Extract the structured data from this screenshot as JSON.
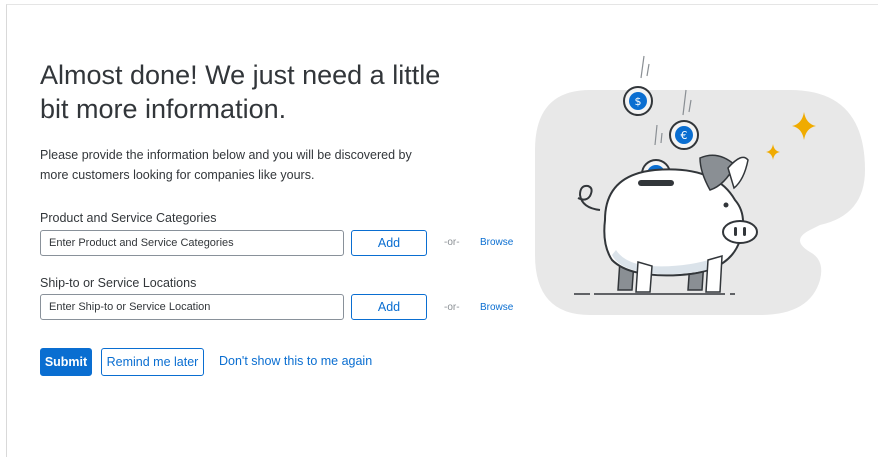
{
  "heading": "Almost done! We just need a little bit more information.",
  "description": "Please provide the information below and you will be discovered by more customers looking for companies like yours.",
  "categories": {
    "label": "Product and Service Categories",
    "placeholder": "Enter Product and Service Categories",
    "add_label": "Add",
    "or_label": "-or-",
    "browse_label": "Browse"
  },
  "locations": {
    "label": "Ship-to or Service Locations",
    "placeholder": "Enter Ship-to or Service Location",
    "add_label": "Add",
    "or_label": "-or-",
    "browse_label": "Browse"
  },
  "actions": {
    "submit_label": "Submit",
    "remind_label": "Remind me later",
    "dont_show_label": "Don't show this to me again"
  },
  "colors": {
    "accent": "#0a6ed1",
    "text": "#32363a",
    "sparkle": "#f0ab00",
    "illustration_bg": "#e8e8e8"
  }
}
